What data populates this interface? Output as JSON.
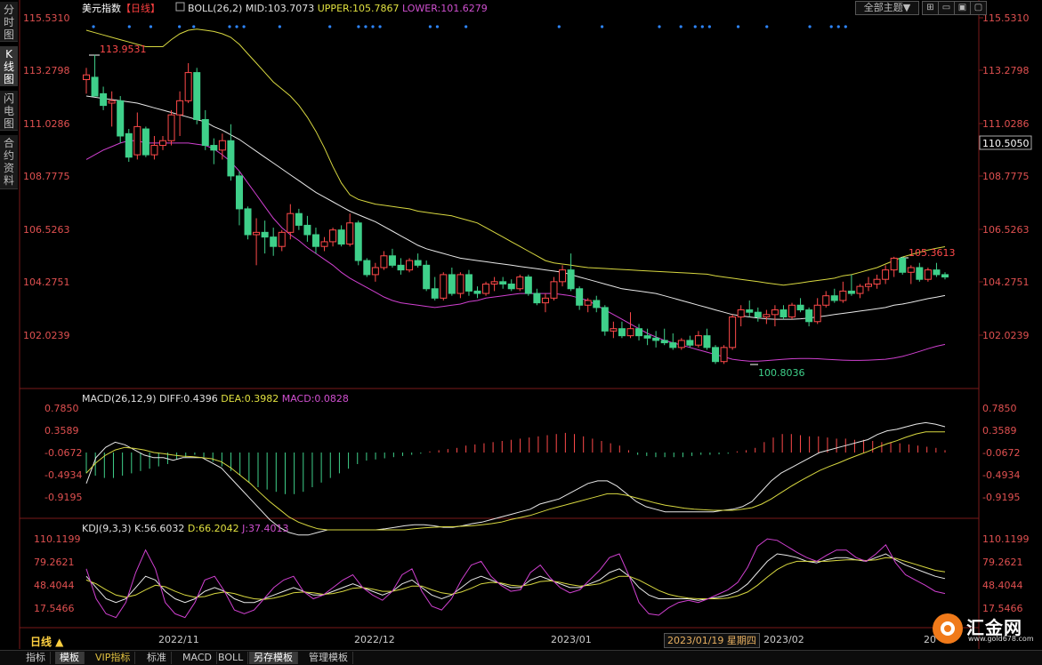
{
  "sidebar": {
    "tabs": [
      {
        "label": "分时图",
        "active": false
      },
      {
        "label": "K线图",
        "active": true
      },
      {
        "label": "闪电图",
        "active": false
      },
      {
        "label": "合约资料",
        "active": false
      }
    ]
  },
  "header": {
    "symbol": "美元指数",
    "period": "【日线】",
    "boll_label": "BOLL(26,2)",
    "mid": "MID:103.7073",
    "upper": "UPPER:105.7867",
    "lower": "LOWER:101.6279",
    "theme_button": "全部主题▼",
    "window_buttons": [
      "⊞",
      "▭",
      "▣",
      "▢",
      "✕"
    ]
  },
  "colors": {
    "up": "#ff4a4a",
    "down": "#3fd08a",
    "upper_band": "#d8d840",
    "mid_band": "#e8e8e8",
    "lower_band": "#d040d0",
    "axis_text": "#e05050",
    "marker": "#2e86ff"
  },
  "price_axis": {
    "labels": [
      "115.5310",
      "113.2798",
      "111.0286",
      "108.7775",
      "106.5263",
      "104.2751",
      "102.0239"
    ],
    "current_price": "110.5050"
  },
  "annotations": {
    "high": "113.9531",
    "low": "100.8036",
    "recent_high": "105.3613"
  },
  "macd": {
    "label": "MACD(26,12,9)",
    "diff": "DIFF:0.4396",
    "dea": "DEA:0.3982",
    "macd": "MACD:0.0828",
    "axis_labels": [
      "0.7850",
      "0.3589",
      "-0.0672",
      "-0.4934",
      "-0.9195"
    ]
  },
  "kdj": {
    "label": "KDJ(9,3,3)",
    "k": "K:56.6032",
    "d": "D:66.2042",
    "j": "J:37.4013",
    "axis_labels": [
      "110.1199",
      "79.2621",
      "48.4044",
      "17.5466"
    ]
  },
  "time_axis": {
    "period_label": "日线 ▲",
    "dates": [
      "2022/11",
      "2022/12",
      "2023/01",
      "2023/02",
      "20"
    ],
    "tooltip_date": "2023/01/19 星期四"
  },
  "bottom_tabs": [
    {
      "label": "指标",
      "active": false
    },
    {
      "label": "模板",
      "active": true
    },
    {
      "label": "VIP指标",
      "active": false,
      "vip": true
    },
    {
      "label": "标准",
      "active": false
    },
    {
      "label": "MACD",
      "active": false
    },
    {
      "label": "BOLL",
      "active": false
    },
    {
      "label": "另存模板",
      "active": true
    },
    {
      "label": "管理模板",
      "active": false
    }
  ],
  "logo": {
    "name": "汇金网",
    "url": "www.gold678.com"
  },
  "chart_data": {
    "type": "candlestick",
    "y_range": [
      100.0,
      115.8
    ],
    "candles": [
      [
        112.9,
        113.4,
        112.3,
        113.1
      ],
      [
        113.0,
        113.95,
        112.5,
        112.2
      ],
      [
        112.3,
        112.6,
        111.6,
        111.8
      ],
      [
        111.9,
        112.4,
        110.9,
        112.0
      ],
      [
        112.0,
        112.2,
        110.2,
        110.5
      ],
      [
        110.6,
        110.8,
        109.4,
        109.6
      ],
      [
        109.7,
        111.5,
        109.5,
        110.9
      ],
      [
        110.8,
        110.9,
        109.6,
        109.7
      ],
      [
        109.7,
        110.5,
        109.5,
        110.1
      ],
      [
        110.1,
        110.5,
        109.9,
        110.3
      ],
      [
        110.3,
        111.6,
        110.1,
        111.4
      ],
      [
        111.4,
        112.4,
        110.5,
        112.0
      ],
      [
        112.0,
        113.6,
        111.9,
        113.2
      ],
      [
        113.2,
        113.4,
        111.0,
        111.2
      ],
      [
        111.2,
        111.6,
        109.9,
        110.1
      ],
      [
        110.1,
        110.4,
        109.3,
        109.9
      ],
      [
        109.9,
        110.6,
        109.5,
        110.3
      ],
      [
        110.3,
        111.0,
        108.6,
        108.8
      ],
      [
        108.8,
        109.0,
        106.7,
        107.4
      ],
      [
        107.4,
        107.5,
        106.1,
        106.3
      ],
      [
        106.3,
        107.0,
        105.0,
        106.4
      ],
      [
        106.4,
        106.9,
        105.5,
        106.2
      ],
      [
        106.2,
        106.6,
        105.4,
        105.8
      ],
      [
        105.8,
        106.5,
        105.6,
        106.4
      ],
      [
        106.4,
        107.6,
        106.1,
        107.2
      ],
      [
        107.2,
        107.4,
        106.5,
        106.7
      ],
      [
        106.7,
        107.1,
        106.0,
        106.3
      ],
      [
        106.3,
        106.6,
        105.5,
        105.8
      ],
      [
        105.8,
        106.2,
        105.6,
        106.0
      ],
      [
        106.0,
        106.6,
        105.8,
        106.5
      ],
      [
        106.5,
        106.7,
        105.8,
        105.9
      ],
      [
        105.9,
        107.2,
        105.8,
        106.8
      ],
      [
        106.8,
        106.9,
        105.0,
        105.2
      ],
      [
        105.2,
        105.3,
        104.5,
        104.6
      ],
      [
        104.6,
        105.1,
        104.3,
        104.9
      ],
      [
        104.9,
        105.6,
        104.8,
        105.4
      ],
      [
        105.4,
        105.7,
        104.9,
        105.0
      ],
      [
        105.0,
        105.3,
        104.6,
        104.8
      ],
      [
        104.8,
        105.3,
        104.7,
        105.2
      ],
      [
        105.2,
        105.5,
        104.9,
        105.0
      ],
      [
        105.0,
        105.2,
        103.9,
        104.0
      ],
      [
        104.0,
        104.5,
        103.5,
        103.6
      ],
      [
        103.6,
        104.7,
        103.5,
        104.6
      ],
      [
        104.6,
        104.9,
        103.7,
        103.8
      ],
      [
        103.8,
        104.7,
        103.6,
        104.6
      ],
      [
        104.6,
        104.8,
        103.7,
        103.9
      ],
      [
        103.9,
        104.1,
        103.6,
        103.8
      ],
      [
        103.8,
        104.3,
        103.7,
        104.2
      ],
      [
        104.2,
        104.5,
        103.9,
        104.3
      ],
      [
        104.3,
        104.5,
        104.0,
        104.2
      ],
      [
        104.2,
        104.4,
        103.9,
        104.0
      ],
      [
        104.0,
        104.6,
        103.9,
        104.5
      ],
      [
        104.5,
        104.6,
        103.7,
        103.8
      ],
      [
        103.8,
        104.0,
        103.3,
        103.4
      ],
      [
        103.4,
        103.8,
        103.0,
        103.6
      ],
      [
        103.6,
        104.5,
        103.5,
        104.3
      ],
      [
        104.3,
        105.0,
        104.1,
        104.8
      ],
      [
        104.8,
        105.5,
        103.9,
        104.0
      ],
      [
        104.0,
        104.1,
        103.1,
        103.3
      ],
      [
        103.3,
        103.6,
        103.0,
        103.5
      ],
      [
        103.5,
        103.7,
        103.0,
        103.2
      ],
      [
        103.2,
        103.3,
        102.0,
        102.2
      ],
      [
        102.2,
        102.6,
        101.9,
        102.3
      ],
      [
        102.3,
        102.6,
        101.9,
        102.0
      ],
      [
        102.0,
        103.0,
        101.9,
        102.3
      ],
      [
        102.3,
        102.5,
        101.8,
        102.0
      ],
      [
        102.0,
        102.3,
        101.6,
        101.9
      ],
      [
        101.9,
        102.2,
        101.5,
        101.8
      ],
      [
        101.8,
        102.3,
        101.6,
        101.7
      ],
      [
        101.7,
        102.1,
        101.4,
        101.5
      ],
      [
        101.5,
        101.9,
        101.4,
        101.8
      ],
      [
        101.8,
        102.0,
        101.5,
        101.6
      ],
      [
        101.6,
        102.2,
        101.5,
        102.0
      ],
      [
        102.0,
        102.3,
        101.4,
        101.5
      ],
      [
        101.5,
        101.6,
        100.8,
        100.9
      ],
      [
        100.9,
        101.6,
        100.8,
        101.5
      ],
      [
        101.5,
        102.9,
        101.4,
        102.8
      ],
      [
        102.8,
        103.3,
        102.4,
        103.1
      ],
      [
        103.1,
        103.5,
        102.8,
        103.0
      ],
      [
        103.0,
        103.2,
        102.6,
        102.8
      ],
      [
        102.8,
        103.1,
        102.5,
        102.9
      ],
      [
        102.9,
        103.3,
        102.4,
        103.1
      ],
      [
        103.1,
        103.3,
        102.7,
        102.8
      ],
      [
        102.8,
        103.4,
        102.7,
        103.3
      ],
      [
        103.3,
        103.6,
        103.0,
        103.1
      ],
      [
        103.1,
        103.2,
        102.4,
        102.6
      ],
      [
        102.6,
        103.6,
        102.5,
        103.3
      ],
      [
        103.3,
        103.9,
        103.2,
        103.7
      ],
      [
        103.7,
        104.0,
        103.4,
        103.5
      ],
      [
        103.5,
        104.3,
        103.4,
        103.9
      ],
      [
        103.9,
        104.6,
        103.7,
        103.8
      ],
      [
        103.8,
        104.2,
        103.6,
        104.1
      ],
      [
        104.1,
        104.5,
        103.9,
        104.2
      ],
      [
        104.2,
        104.6,
        104.0,
        104.4
      ],
      [
        104.4,
        105.0,
        104.2,
        104.8
      ],
      [
        104.8,
        105.36,
        104.5,
        105.3
      ],
      [
        105.3,
        105.36,
        104.6,
        104.7
      ],
      [
        104.7,
        105.0,
        104.2,
        104.9
      ],
      [
        104.9,
        105.1,
        104.3,
        104.4
      ],
      [
        104.4,
        104.9,
        104.3,
        104.8
      ],
      [
        104.8,
        105.1,
        104.5,
        104.6
      ],
      [
        104.6,
        104.7,
        104.4,
        104.5
      ]
    ],
    "boll_upper": [
      115.0,
      114.9,
      114.8,
      114.7,
      114.6,
      114.5,
      114.4,
      114.3,
      114.3,
      114.3,
      114.6,
      114.85,
      115.0,
      115.05,
      115.0,
      114.95,
      114.85,
      114.7,
      114.4,
      114.0,
      113.6,
      113.2,
      112.8,
      112.5,
      112.2,
      111.8,
      111.3,
      110.7,
      110.0,
      109.2,
      108.5,
      108.0,
      107.8,
      107.7,
      107.6,
      107.55,
      107.5,
      107.45,
      107.4,
      107.3,
      107.25,
      107.2,
      107.15,
      107.1,
      107.0,
      106.9,
      106.8,
      106.6,
      106.4,
      106.2,
      106.0,
      105.8,
      105.6,
      105.4,
      105.2,
      105.1,
      105.05,
      105.0,
      104.95,
      104.9,
      104.88,
      104.86,
      104.84,
      104.82,
      104.8,
      104.78,
      104.76,
      104.74,
      104.72,
      104.7,
      104.68,
      104.66,
      104.64,
      104.62,
      104.55,
      104.5,
      104.45,
      104.4,
      104.35,
      104.3,
      104.25,
      104.2,
      104.15,
      104.2,
      104.25,
      104.3,
      104.35,
      104.4,
      104.45,
      104.55,
      104.6,
      104.7,
      104.8,
      104.9,
      105.05,
      105.2,
      105.35,
      105.45,
      105.55,
      105.65,
      105.72,
      105.79
    ],
    "boll_mid": [
      112.2,
      112.15,
      112.1,
      112.05,
      112.0,
      111.95,
      111.9,
      111.8,
      111.7,
      111.6,
      111.5,
      111.4,
      111.3,
      111.2,
      111.1,
      110.9,
      110.75,
      110.55,
      110.35,
      110.1,
      109.85,
      109.6,
      109.35,
      109.1,
      108.85,
      108.6,
      108.35,
      108.1,
      107.9,
      107.7,
      107.5,
      107.3,
      107.15,
      107.0,
      106.85,
      106.65,
      106.45,
      106.25,
      106.05,
      105.85,
      105.7,
      105.6,
      105.5,
      105.4,
      105.3,
      105.25,
      105.2,
      105.15,
      105.1,
      105.05,
      105.0,
      104.95,
      104.9,
      104.85,
      104.8,
      104.75,
      104.7,
      104.6,
      104.5,
      104.4,
      104.3,
      104.2,
      104.1,
      104.0,
      103.95,
      103.9,
      103.85,
      103.8,
      103.7,
      103.6,
      103.5,
      103.4,
      103.3,
      103.2,
      103.1,
      103.0,
      102.9,
      102.85,
      102.8,
      102.75,
      102.72,
      102.7,
      102.7,
      102.7,
      102.72,
      102.75,
      102.8,
      102.85,
      102.9,
      102.95,
      103.0,
      103.05,
      103.1,
      103.15,
      103.2,
      103.3,
      103.35,
      103.42,
      103.5,
      103.58,
      103.64,
      103.71
    ],
    "boll_lower": [
      109.5,
      109.7,
      109.9,
      110.05,
      110.2,
      110.3,
      110.3,
      110.2,
      110.2,
      110.2,
      110.2,
      110.2,
      110.2,
      110.15,
      110.1,
      109.95,
      109.7,
      109.4,
      109.0,
      108.5,
      108.0,
      107.5,
      107.0,
      106.6,
      106.3,
      106.05,
      105.75,
      105.5,
      105.25,
      105.0,
      104.7,
      104.45,
      104.25,
      104.05,
      103.85,
      103.65,
      103.5,
      103.4,
      103.35,
      103.3,
      103.25,
      103.2,
      103.25,
      103.3,
      103.35,
      103.45,
      103.5,
      103.6,
      103.65,
      103.7,
      103.75,
      103.8,
      103.8,
      103.8,
      103.8,
      103.8,
      103.75,
      103.7,
      103.6,
      103.5,
      103.3,
      103.1,
      102.9,
      102.7,
      102.5,
      102.3,
      102.1,
      101.95,
      101.8,
      101.7,
      101.6,
      101.5,
      101.4,
      101.3,
      101.2,
      101.1,
      101.0,
      100.95,
      100.92,
      100.92,
      100.94,
      100.97,
      101.0,
      101.02,
      101.03,
      101.03,
      101.02,
      101.0,
      100.98,
      100.96,
      100.95,
      100.95,
      100.96,
      100.98,
      101.0,
      101.05,
      101.12,
      101.22,
      101.33,
      101.45,
      101.55,
      101.63
    ]
  }
}
